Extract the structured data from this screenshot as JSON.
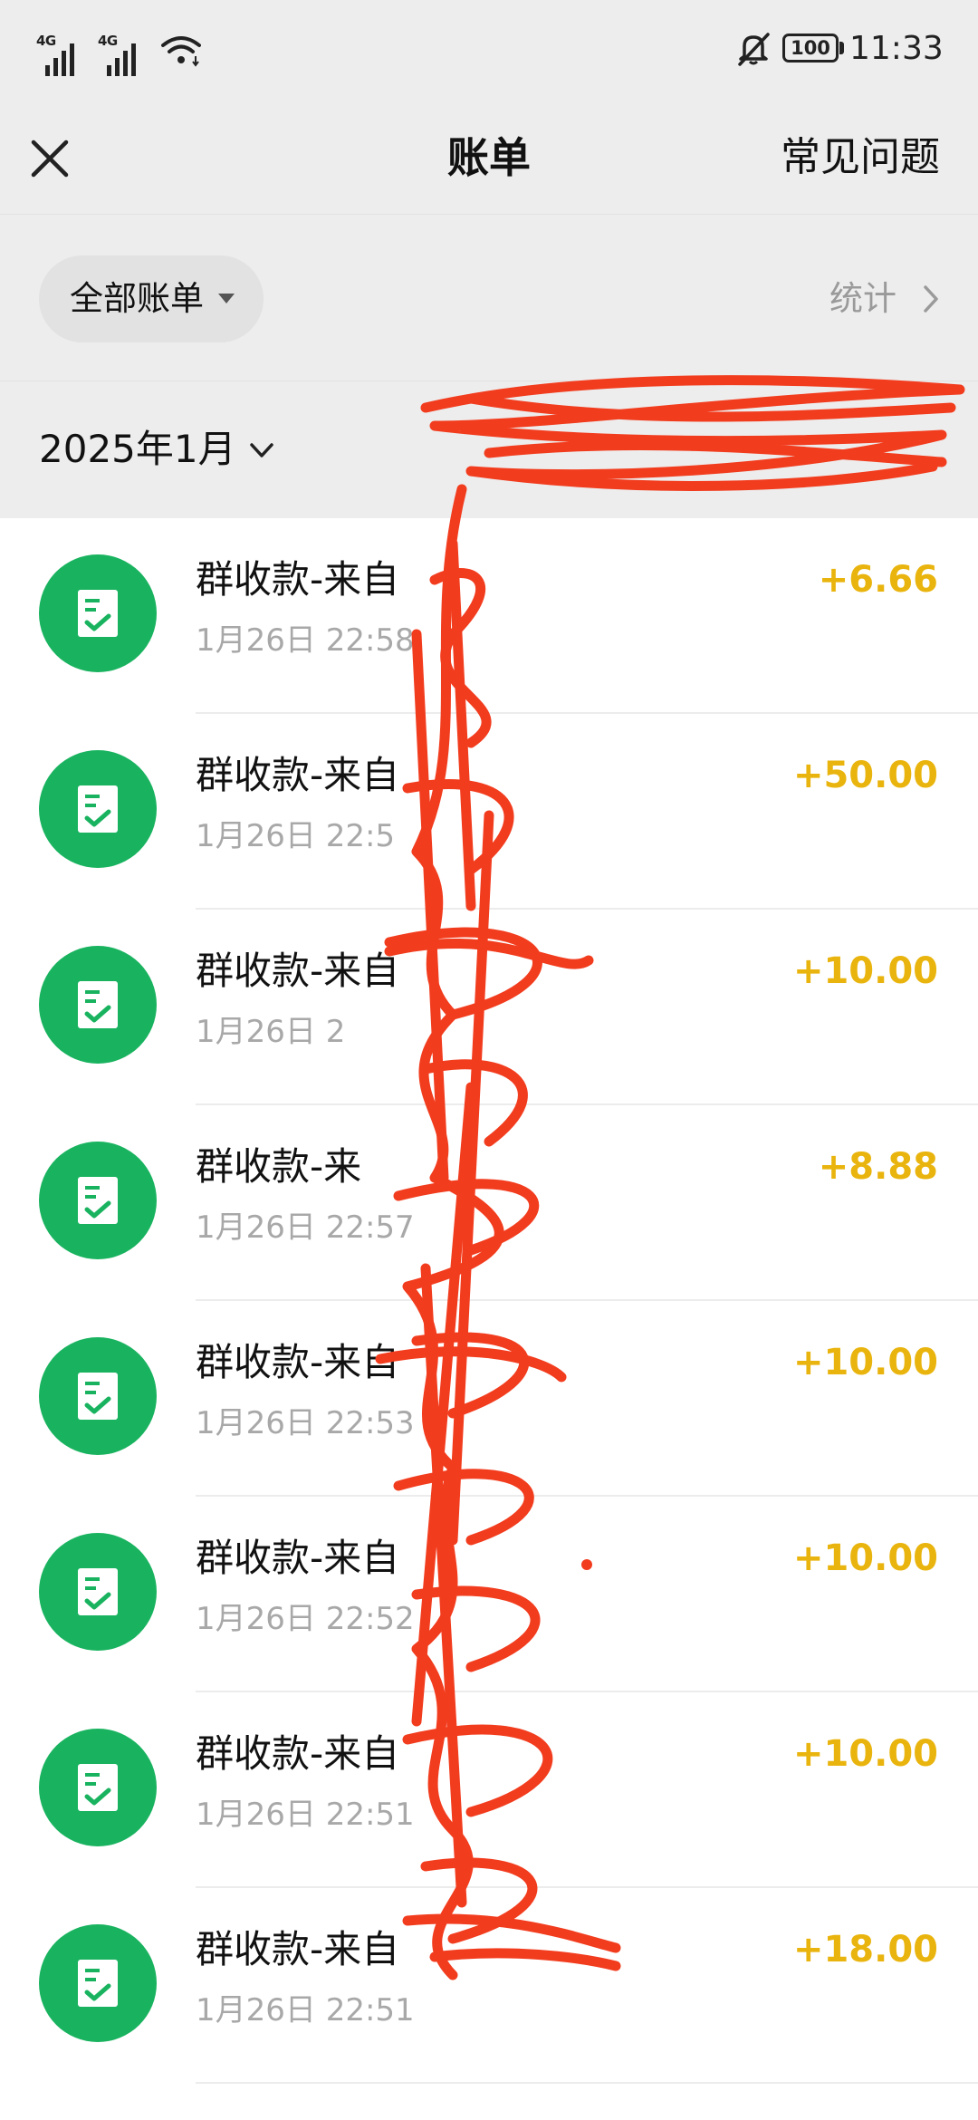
{
  "status_bar": {
    "network_1": "4G",
    "network_2": "4G",
    "battery": "100",
    "time": "11:33"
  },
  "nav": {
    "title": "账单",
    "faq": "常见问题"
  },
  "filter": {
    "label": "全部账单",
    "stats": "统计"
  },
  "month": {
    "label": "2025年1月"
  },
  "transactions": [
    {
      "title": "群收款-来自",
      "time": "1月26日 22:58",
      "amount": "+6.66"
    },
    {
      "title": "群收款-来自",
      "time": "1月26日 22:5",
      "amount": "+50.00"
    },
    {
      "title": "群收款-来自",
      "time": "1月26日 2",
      "amount": "+10.00"
    },
    {
      "title": "群收款-来",
      "time": "1月26日 22:57",
      "amount": "+8.88"
    },
    {
      "title": "群收款-来自",
      "time": "1月26日 22:53",
      "amount": "+10.00"
    },
    {
      "title": "群收款-来自",
      "time": "1月26日 22:52",
      "amount": "+10.00"
    },
    {
      "title": "群收款-来自",
      "time": "1月26日 22:51",
      "amount": "+10.00"
    },
    {
      "title": "群收款-来自",
      "time": "1月26日 22:51",
      "amount": "+18.00"
    }
  ],
  "colors": {
    "icon_green": "#19b35f",
    "amount_yellow": "#e9b40d",
    "redaction_red": "#f23c1e"
  },
  "icons": {
    "close": "close-icon",
    "dropdown": "caret-down-icon",
    "stats_arrow": "chevron-right-icon",
    "month_toggle": "chevron-down-icon",
    "transaction": "receipt-check-icon"
  }
}
